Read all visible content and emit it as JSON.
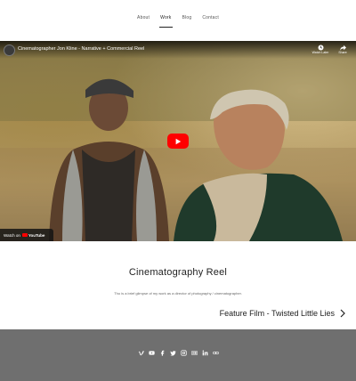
{
  "nav": {
    "items": [
      {
        "label": "About",
        "active": false
      },
      {
        "label": "Work",
        "active": true
      },
      {
        "label": "Blog",
        "active": false
      },
      {
        "label": "Contact",
        "active": false
      }
    ]
  },
  "video": {
    "title": "Cinematographer Jon Kline - Narrative + Commercial Reel",
    "watch_later": "Watch Later",
    "share": "Share",
    "watch_on": "Watch on",
    "youtube": "YouTube"
  },
  "content": {
    "title": "Cinematography Reel",
    "description": "Tho is a brief glimpse of my work as a director of photography / cinematographer.",
    "next_link": "Feature Film - Twisted Little Lies"
  },
  "footer": {
    "social_icons": [
      "vimeo-icon",
      "youtube-icon",
      "facebook-icon",
      "twitter-icon",
      "instagram-icon",
      "imdb-icon",
      "linkedin-icon",
      "link-icon"
    ]
  },
  "colors": {
    "footer_bg": "#6f6f6f",
    "play_red": "#ff0000",
    "text": "#222222"
  }
}
